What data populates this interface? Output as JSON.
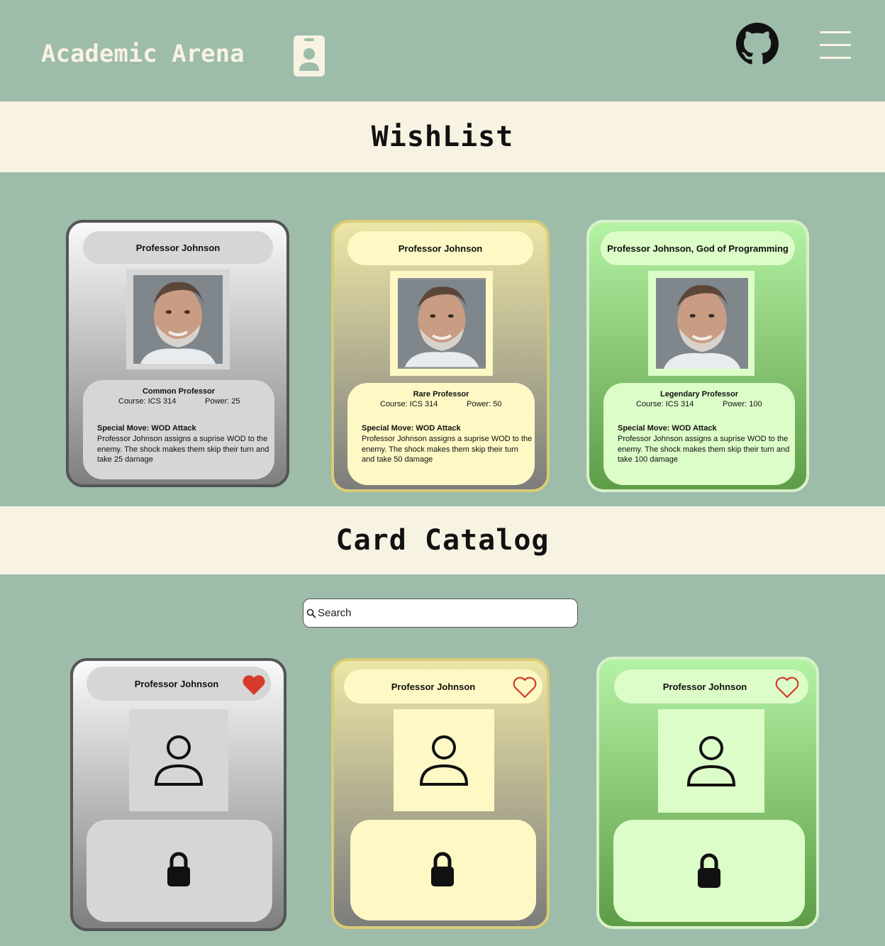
{
  "header": {
    "brand": "Academic Arena",
    "profile_icon": "id-badge-icon",
    "github_icon": "github-icon",
    "menu_icon": "hamburger-menu-icon"
  },
  "wishlist": {
    "title": "WishList",
    "cards": [
      {
        "name": "Professor Johnson",
        "rarity": "Common Professor",
        "course": "Course: ICS 314",
        "power": "Power: 25",
        "move_title": "Special Move: WOD Attack",
        "move_desc": "Professor Johnson assigns a suprise WOD to the enemy. The shock makes them skip their turn and take 25 damage"
      },
      {
        "name": "Professor Johnson",
        "rarity": "Rare Professor",
        "course": "Course: ICS 314",
        "power": "Power: 50",
        "move_title": "Special Move: WOD Attack",
        "move_desc": "Professor Johnson assigns a suprise WOD to the enemy. The shock makes them skip their turn and take 50 damage"
      },
      {
        "name": "Professor Johnson, God of Programming",
        "rarity": "Legendary Professor",
        "course": "Course: ICS 314",
        "power": "Power: 100",
        "move_title": "Special Move: WOD Attack",
        "move_desc": "Professor Johnson assigns a suprise WOD to the enemy. The shock makes them skip their turn and take 100 damage"
      }
    ]
  },
  "catalog": {
    "title": "Card Catalog",
    "search_placeholder": "Search",
    "cards": [
      {
        "name": "Professor Johnson",
        "favorited": true,
        "locked": true
      },
      {
        "name": "Professor Johnson",
        "favorited": false,
        "locked": true
      },
      {
        "name": "Professor Johnson",
        "favorited": false,
        "locked": true
      }
    ]
  },
  "colors": {
    "background": "#9dbcaa",
    "band": "#f8f2e2",
    "heart": "#d63a2a"
  }
}
